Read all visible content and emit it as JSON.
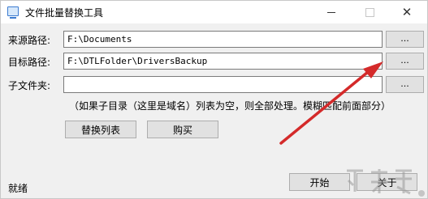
{
  "window": {
    "title": "文件批量替换工具"
  },
  "form": {
    "source_label": "来源路径:",
    "source_value": "F:\\Documents",
    "target_label": "目标路径:",
    "target_value": "F:\\DTLFolder\\DriversBackup",
    "subfolder_label": "子文件夹:",
    "subfolder_value": "",
    "browse_label": "...",
    "hint": "（如果子目录（这里是域名）列表为空，则全部处理。模糊匹配前面部分）"
  },
  "buttons": {
    "replace_list": "替换列表",
    "buy": "购买",
    "start": "开始",
    "about": "关于"
  },
  "status": {
    "text": "就绪"
  },
  "colors": {
    "arrow": "#d42a2a",
    "window_bg": "#f0f0f0",
    "field_border": "#7a7a7a",
    "button_bg": "#e1e1e1"
  }
}
